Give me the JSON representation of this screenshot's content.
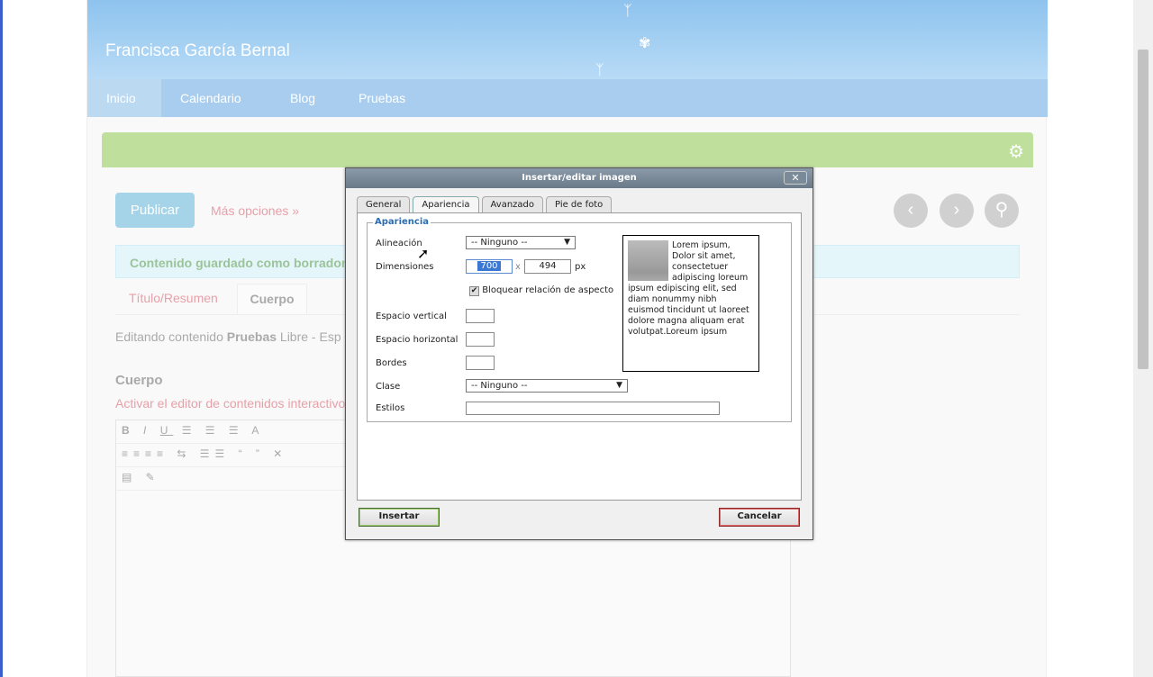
{
  "site": {
    "title": "Francisca García Bernal",
    "nav": [
      "Inicio",
      "Calendario",
      "Blog",
      "Pruebas"
    ]
  },
  "toolbar": {
    "publish": "Publicar",
    "more": "Más opciones »",
    "prev_icon": "‹",
    "next_icon": "›",
    "search_icon": "⚲"
  },
  "message": "Contenido guardado como borrador",
  "tabs": [
    "Título/Resumen",
    "Cuerpo"
  ],
  "editing": {
    "prefix": "Editando contenido",
    "name": "Pruebas",
    "suffix": "Libre - Esp"
  },
  "body": {
    "heading": "Cuerpo",
    "activate": "Activar el editor de contenidos interactivo"
  },
  "dialog": {
    "title": "Insertar/editar imagen",
    "close": "✕",
    "tabs": [
      "General",
      "Apariencia",
      "Avanzado",
      "Pie de foto"
    ],
    "legend": "Apariencia",
    "labels": {
      "align": "Alineación",
      "dims": "Dimensiones",
      "vspace": "Espacio vertical",
      "hspace": "Espacio horizontal",
      "border": "Bordes",
      "class": "Clase",
      "styles": "Estilos"
    },
    "align_value": "-- Ninguno --",
    "class_value": "-- Ninguno --",
    "width": "700",
    "height": "494",
    "x": "x",
    "px": "px",
    "lock": "Bloquear relación de aspecto",
    "preview": "Lorem ipsum, Dolor sit amet, consectetuer adipiscing loreum ipsum edipiscing elit, sed diam nonummy nibh euismod tincidunt ut laoreet dolore magna aliquam erat volutpat.Loreum ipsum",
    "insert": "Insertar",
    "cancel": "Cancelar"
  }
}
